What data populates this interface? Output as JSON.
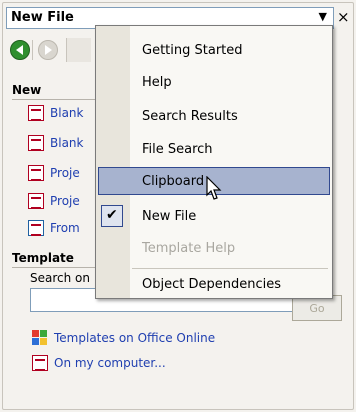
{
  "title": {
    "text": "New File",
    "close_glyph": "×",
    "dropdown_glyph": "▼"
  },
  "toolbar": {
    "back_icon": "back-arrow-icon",
    "forward_icon": "forward-arrow-icon"
  },
  "new_section": {
    "heading": "New",
    "items": [
      {
        "label": "Blank",
        "icon": "blank-database-icon"
      },
      {
        "label": "Blank",
        "icon": "blank-page-icon"
      },
      {
        "label": "Proje",
        "icon": "project-icon"
      },
      {
        "label": "Proje",
        "icon": "project-icon"
      },
      {
        "label": "From",
        "icon": "from-file-icon"
      }
    ]
  },
  "templates_section": {
    "heading": "Template",
    "search_label": "Search on",
    "search_value": "",
    "go_label": "Go",
    "links": [
      {
        "label": "Templates on Office Online",
        "icon": "office-online-icon"
      },
      {
        "label": "On my computer...",
        "icon": "computer-template-icon"
      }
    ]
  },
  "menu": {
    "items": [
      {
        "label": "Getting Started",
        "checked": false,
        "disabled": false,
        "highlight": false
      },
      {
        "label": "Help",
        "checked": false,
        "disabled": false,
        "highlight": false
      },
      {
        "label": "Search Results",
        "checked": false,
        "disabled": false,
        "highlight": false
      },
      {
        "label": "File Search",
        "checked": false,
        "disabled": false,
        "highlight": false
      },
      {
        "label": "Clipboard",
        "checked": false,
        "disabled": false,
        "highlight": true
      },
      {
        "label": "New File",
        "checked": true,
        "disabled": false,
        "highlight": false
      },
      {
        "label": "Template Help",
        "checked": false,
        "disabled": true,
        "highlight": false
      },
      {
        "label": "Object Dependencies",
        "checked": false,
        "disabled": false,
        "highlight": false
      }
    ]
  },
  "colors": {
    "link": "#1f3fb0",
    "highlight_bg": "#a7b3cf",
    "highlight_border": "#31498f",
    "disabled_text": "#a9a7a0"
  }
}
